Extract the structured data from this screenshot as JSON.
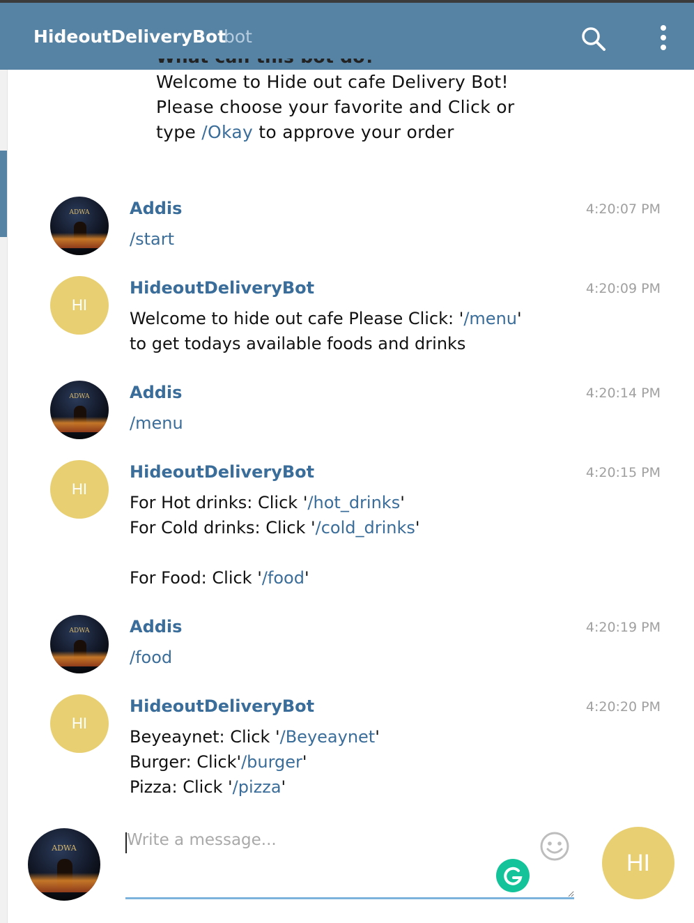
{
  "header": {
    "title": "HideoutDeliveryBot",
    "subtitle": "bot"
  },
  "intro": {
    "heading_partial": "What can this bot do?",
    "line1": "Welcome to Hide out cafe Delivery Bot!",
    "line2": "Please choose your favorite and Click or",
    "line3_pre": "type ",
    "line3_cmd": "/Okay",
    "line3_post": " to approve your order"
  },
  "messages": [
    {
      "sender": "Addis",
      "time": "4:20:07 PM",
      "avatar": "photo",
      "lines": [
        [
          {
            "t": "/start",
            "cmd": true
          }
        ]
      ]
    },
    {
      "sender": "HideoutDeliveryBot",
      "time": "4:20:09 PM",
      "avatar": "HI",
      "lines": [
        [
          {
            "t": "Welcome to hide out cafe Please Click: '"
          },
          {
            "t": "/menu",
            "cmd": true
          },
          {
            "t": "'"
          }
        ],
        [
          {
            "t": "to get todays available foods and drinks"
          }
        ]
      ]
    },
    {
      "sender": "Addis",
      "time": "4:20:14 PM",
      "avatar": "photo",
      "lines": [
        [
          {
            "t": "/menu",
            "cmd": true
          }
        ]
      ]
    },
    {
      "sender": "HideoutDeliveryBot",
      "time": "4:20:15 PM",
      "avatar": "HI",
      "lines": [
        [
          {
            "t": "For Hot drinks: Click '"
          },
          {
            "t": "/hot_drinks",
            "cmd": true
          },
          {
            "t": "'"
          }
        ],
        [
          {
            "t": "For Cold drinks: Click '"
          },
          {
            "t": "/cold_drinks",
            "cmd": true
          },
          {
            "t": "'"
          }
        ],
        [],
        [
          {
            "t": "For Food: Click '"
          },
          {
            "t": "/food",
            "cmd": true
          },
          {
            "t": "'"
          }
        ]
      ]
    },
    {
      "sender": "Addis",
      "time": "4:20:19 PM",
      "avatar": "photo",
      "lines": [
        [
          {
            "t": "/food",
            "cmd": true
          }
        ]
      ]
    },
    {
      "sender": "HideoutDeliveryBot",
      "time": "4:20:20 PM",
      "avatar": "HI",
      "lines": [
        [
          {
            "t": "Beyeaynet: Click '"
          },
          {
            "t": "/Beyeaynet",
            "cmd": true
          },
          {
            "t": "'"
          }
        ],
        [
          {
            "t": "Burger: Click'"
          },
          {
            "t": "/burger",
            "cmd": true
          },
          {
            "t": "'"
          }
        ],
        [
          {
            "t": "Pizza: Click '"
          },
          {
            "t": "/pizza",
            "cmd": true
          },
          {
            "t": "'"
          }
        ]
      ]
    }
  ],
  "avatar_logo_text": "ADWA",
  "composer": {
    "placeholder": "Write a message...",
    "send_avatar_initials": "HI"
  },
  "icons": {
    "search": "search-icon",
    "more": "more-vertical-icon",
    "emoji": "smiley-icon",
    "grammarly": "grammarly-icon"
  },
  "colors": {
    "header_bg": "#5682a3",
    "link": "#3a6d99",
    "bot_avatar": "#e8cf72",
    "input_underline": "#7bb3dc"
  }
}
